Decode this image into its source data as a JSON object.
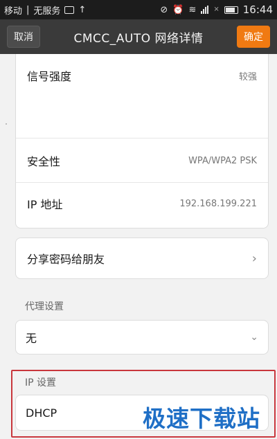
{
  "status_bar": {
    "carrier": "移动",
    "service": "无服务",
    "time": "16:44"
  },
  "action_bar": {
    "cancel_label": "取消",
    "title": "CMCC_AUTO 网络详情",
    "confirm_label": "确定",
    "accent_color": "#f07a12"
  },
  "details": [
    {
      "label": "信号强度",
      "value": "较强"
    },
    {
      "label": "安全性",
      "value": "WPA/WPA2 PSK"
    },
    {
      "label": "IP 地址",
      "value": "192.168.199.221"
    }
  ],
  "share": {
    "label": "分享密码给朋友"
  },
  "proxy": {
    "section_label": "代理设置",
    "value": "无"
  },
  "ip_settings": {
    "section_label": "IP 设置",
    "value": "DHCP"
  },
  "watermark": "极速下载站"
}
